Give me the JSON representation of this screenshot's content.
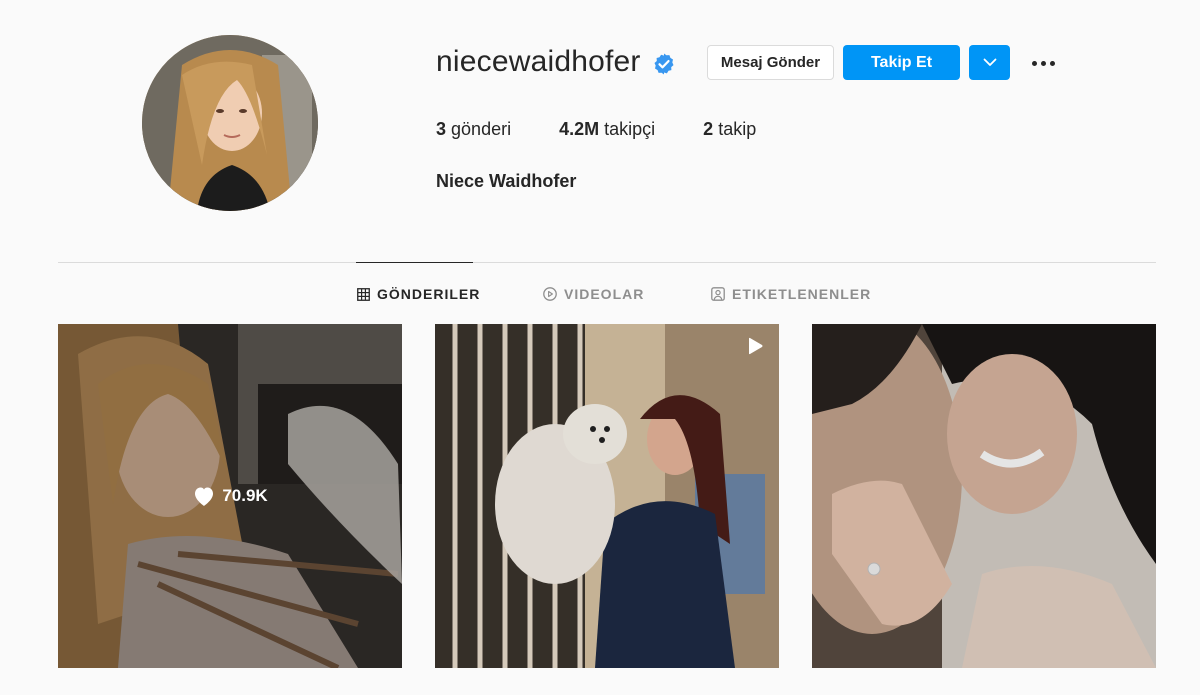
{
  "profile": {
    "username": "niecewaidhofer",
    "full_name": "Niece Waidhofer",
    "verified": true,
    "avatar_icon": "profile-photo"
  },
  "actions": {
    "message_label": "Mesaj Gönder",
    "follow_label": "Takip Et",
    "dropdown_icon": "chevron-down-icon",
    "more_icon": "more-options-icon"
  },
  "stats": {
    "posts_count": "3",
    "posts_label": "gönderi",
    "followers_count": "4.2M",
    "followers_label": "takipçi",
    "following_count": "2",
    "following_label": "takip"
  },
  "tabs": [
    {
      "label": "GÖNDERILER",
      "icon": "grid-icon",
      "active": true
    },
    {
      "label": "VIDEOLAR",
      "icon": "play-circle-icon",
      "active": false
    },
    {
      "label": "ETIKETLENENLER",
      "icon": "tagged-user-icon",
      "active": false
    }
  ],
  "posts": [
    {
      "type": "photo",
      "likes": "70.9K",
      "hover": true
    },
    {
      "type": "video",
      "likes": "",
      "hover": false
    },
    {
      "type": "photo",
      "likes": "",
      "hover": false
    }
  ],
  "colors": {
    "accent": "#0095f6",
    "verified": "#3897f0",
    "background": "#fafafa",
    "border": "#dbdbdb",
    "text": "#262626",
    "muted": "#8e8e8e"
  }
}
